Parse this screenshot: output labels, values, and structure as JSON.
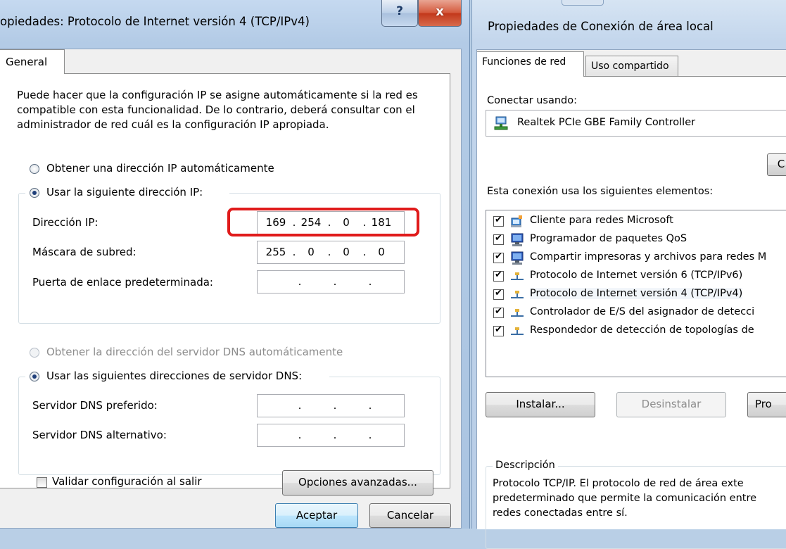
{
  "left_dialog": {
    "title": "opiedades: Protocolo de Internet versión 4 (TCP/IPv4)",
    "help_glyph": "?",
    "close_glyph": "x",
    "tab_general": "General",
    "intro": "Puede hacer que la configuración IP se asigne automáticamente si la red es compatible con esta funcionalidad. De lo contrario, deberá consultar con el administrador de red cuál es la configuración IP apropiada.",
    "radio_auto_ip": "Obtener una dirección IP automáticamente",
    "radio_manual_ip": "Usar la siguiente dirección IP:",
    "ip_label": "Dirección IP:",
    "ip_value": [
      "169",
      "254",
      "0",
      "181"
    ],
    "mask_label": "Máscara de subred:",
    "mask_value": [
      "255",
      "0",
      "0",
      "0"
    ],
    "gateway_label": "Puerta de enlace predeterminada:",
    "gateway_value": [
      "",
      "",
      "",
      ""
    ],
    "radio_auto_dns": "Obtener la dirección del servidor DNS automáticamente",
    "radio_manual_dns": "Usar las siguientes direcciones de servidor DNS:",
    "dns_pref_label": "Servidor DNS preferido:",
    "dns_alt_label": "Servidor DNS alternativo:",
    "validate_label": "Validar configuración al salir",
    "advanced_button": "Opciones avanzadas...",
    "ok_button": "Aceptar",
    "cancel_button": "Cancelar",
    "highlight_color": "#e01b1b"
  },
  "right_dialog": {
    "title": "Propiedades de Conexión de área local",
    "tabs": [
      "Funciones de red",
      "Uso compartido"
    ],
    "connect_using": "Conectar usando:",
    "adapter": "Realtek PCIe GBE Family Controller",
    "configure_button": "C",
    "items_label": "Esta conexión usa los siguientes elementos:",
    "items": [
      {
        "label": "Cliente para redes Microsoft",
        "icon": "client-icon"
      },
      {
        "label": "Programador de paquetes QoS",
        "icon": "service-icon"
      },
      {
        "label": "Compartir impresoras y archivos para redes M",
        "icon": "service-icon"
      },
      {
        "label": "Protocolo de Internet versión 6 (TCP/IPv6)",
        "icon": "protocol-icon"
      },
      {
        "label": "Protocolo de Internet versión 4 (TCP/IPv4)",
        "icon": "protocol-icon"
      },
      {
        "label": "Controlador de E/S del asignador de detecci",
        "icon": "protocol-icon"
      },
      {
        "label": "Respondedor de detección de topologías de",
        "icon": "protocol-icon"
      }
    ],
    "install_button": "Instalar...",
    "uninstall_button": "Desinstalar",
    "properties_button": "Pro",
    "description_title": "Descripción",
    "description_text": "Protocolo TCP/IP. El protocolo de red de área exte predeterminado que permite la comunicación entre redes conectadas entre sí."
  }
}
